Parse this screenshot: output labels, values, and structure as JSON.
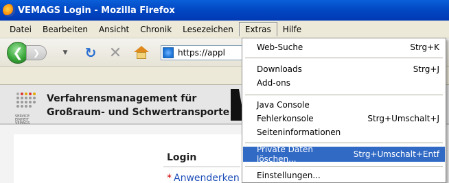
{
  "window": {
    "title": "VEMAGS Login - Mozilla Firefox"
  },
  "menubar": {
    "items": [
      "Datei",
      "Bearbeiten",
      "Ansicht",
      "Chronik",
      "Lesezeichen",
      "Extras",
      "Hilfe"
    ]
  },
  "navbar": {
    "url": "https://appl"
  },
  "page": {
    "org_title_line1": "Verfahrensmanagement für",
    "org_title_line2": "Großraum- und Schwertransporte",
    "logo_small_text": "SERVICE EINHEIT VEMAGS",
    "login_heading": "Login",
    "username_label": "Anwenderken",
    "required_marker": "*"
  },
  "extras_menu": {
    "items": [
      {
        "label": "Web-Suche",
        "shortcut": "Strg+K"
      },
      {
        "label": "Downloads",
        "shortcut": "Strg+J"
      },
      {
        "label": "Add-ons",
        "shortcut": ""
      },
      {
        "label": "Java Console",
        "shortcut": ""
      },
      {
        "label": "Fehlerkonsole",
        "shortcut": "Strg+Umschalt+J"
      },
      {
        "label": "Seiteninformationen",
        "shortcut": ""
      },
      {
        "label": "Private Daten löschen...",
        "shortcut": "Strg+Umschalt+Entf"
      },
      {
        "label": "Einstellungen...",
        "shortcut": ""
      }
    ],
    "highlighted": "Private Daten löschen..."
  },
  "colors": {
    "titlebar": "#0348c4",
    "menu_highlight": "#316ac5",
    "chrome": "#ece9d8",
    "link_blue": "#1e4fb8",
    "required_red": "#d60000"
  }
}
